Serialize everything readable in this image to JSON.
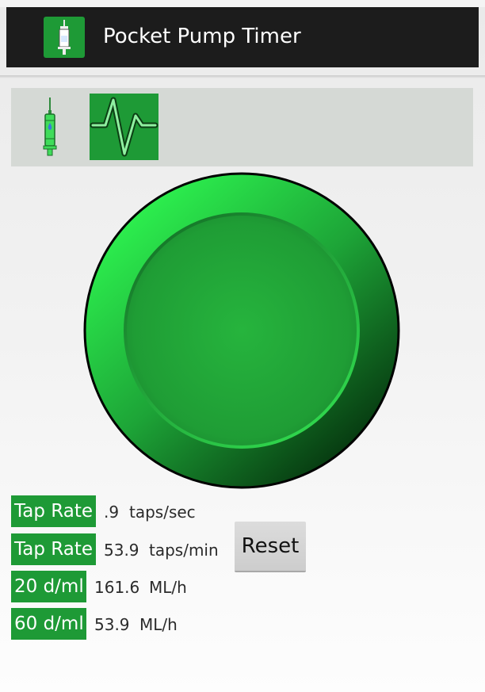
{
  "app": {
    "title": "Pocket Pump Timer",
    "icon": "syringe-icon"
  },
  "toolbar": {
    "items": [
      {
        "icon": "syringe-icon",
        "selected": false
      },
      {
        "icon": "pulse-icon",
        "selected": true
      }
    ]
  },
  "tap_button": {
    "icon": "tap-circle"
  },
  "readouts": [
    {
      "label": "Tap Rate",
      "value": ".9",
      "unit": "taps/sec"
    },
    {
      "label": "Tap Rate",
      "value": "53.9",
      "unit": "taps/min"
    },
    {
      "label": "20 d/ml",
      "value": "161.6",
      "unit": "ML/h"
    },
    {
      "label": "60 d/ml",
      "value": "53.9",
      "unit": "ML/h"
    }
  ],
  "reset": {
    "label": "Reset"
  },
  "colors": {
    "accent": "#1e9a36",
    "action_bar": "#1c1c1c",
    "toolbar_bg": "#d5d9d5"
  }
}
